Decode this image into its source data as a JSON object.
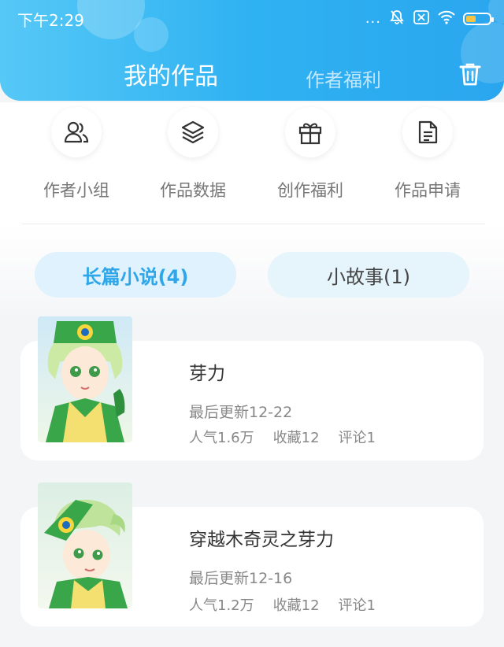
{
  "status_bar": {
    "time": "下午2:29",
    "dots": "..."
  },
  "header": {
    "tab_active": "我的作品",
    "tab_inactive": "作者福利"
  },
  "actions": [
    {
      "label": "作者小组",
      "icon": "users-icon"
    },
    {
      "label": "作品数据",
      "icon": "layers-icon"
    },
    {
      "label": "创作福利",
      "icon": "gift-icon"
    },
    {
      "label": "作品申请",
      "icon": "document-icon"
    }
  ],
  "categories": [
    {
      "label": "长篇小说(4)",
      "active": true
    },
    {
      "label": "小故事(1)",
      "active": false
    }
  ],
  "works": [
    {
      "title": "芽力",
      "updated": "最后更新12-22",
      "popularity": "人气1.6万",
      "favorites": "收藏12",
      "comments": "评论1"
    },
    {
      "title": "穿越木奇灵之芽力",
      "updated": "最后更新12-16",
      "popularity": "人气1.2万",
      "favorites": "收藏12",
      "comments": "评论1"
    }
  ],
  "colors": {
    "accent": "#2ea6ea",
    "header_start": "#56c8f6",
    "header_end": "#2aa6ee"
  }
}
